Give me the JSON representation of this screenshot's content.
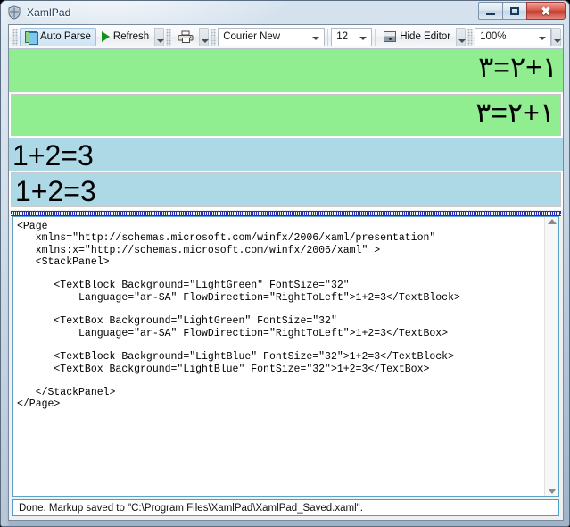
{
  "window": {
    "title": "XamlPad",
    "icon": "shield-icon",
    "caption_buttons": {
      "minimize": "minimize-button",
      "maximize": "maximize-button",
      "close": "close-button"
    }
  },
  "toolbar": {
    "auto_parse_label": "Auto Parse",
    "auto_parse_checked": true,
    "refresh_label": "Refresh",
    "print_label": "",
    "hide_editor_label": "Hide Editor",
    "font_family_value": "Courier New",
    "font_size_value": "12",
    "zoom_value": "100%"
  },
  "preview": {
    "blocks": [
      {
        "kind": "TextBlock",
        "background": "LightGreen",
        "background_hex": "#90EE90",
        "font_size": "32",
        "language": "ar-SA",
        "flow_direction": "RightToLeft",
        "text": "١+٢=٣"
      },
      {
        "kind": "TextBox",
        "background": "LightGreen",
        "background_hex": "#90EE90",
        "font_size": "32",
        "language": "ar-SA",
        "flow_direction": "RightToLeft",
        "text": "١+٢=٣"
      },
      {
        "kind": "TextBlock",
        "background": "LightBlue",
        "background_hex": "#ADD8E6",
        "font_size": "32",
        "language": "",
        "flow_direction": "LeftToRight",
        "text": "1+2=3"
      },
      {
        "kind": "TextBox",
        "background": "LightBlue",
        "background_hex": "#ADD8E6",
        "font_size": "32",
        "language": "",
        "flow_direction": "LeftToRight",
        "text": "1+2=3"
      }
    ]
  },
  "editor": {
    "markup": "<Page\n   xmlns=\"http://schemas.microsoft.com/winfx/2006/xaml/presentation\"\n   xmlns:x=\"http://schemas.microsoft.com/winfx/2006/xaml\" >\n   <StackPanel>\n\n      <TextBlock Background=\"LightGreen\" FontSize=\"32\"\n          Language=\"ar-SA\" FlowDirection=\"RightToLeft\">1+2=3</TextBlock>\n\n      <TextBox Background=\"LightGreen\" FontSize=\"32\"\n          Language=\"ar-SA\" FlowDirection=\"RightToLeft\">1+2=3</TextBox>\n\n      <TextBlock Background=\"LightBlue\" FontSize=\"32\">1+2=3</TextBlock>\n      <TextBox Background=\"LightBlue\" FontSize=\"32\">1+2=3</TextBox>\n\n   </StackPanel>\n</Page>"
  },
  "statusbar": {
    "message": "Done. Markup saved to \"C:\\Program Files\\XamlPad\\XamlPad_Saved.xaml\"."
  }
}
